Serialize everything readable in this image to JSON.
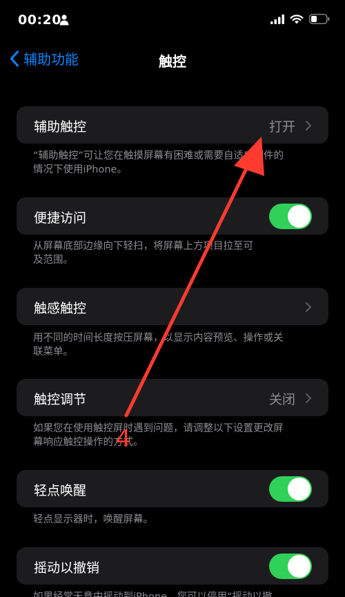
{
  "status_bar": {
    "time": "00:20",
    "icons": [
      "person-icon",
      "signal-icon",
      "wifi-icon",
      "battery-icon"
    ]
  },
  "nav": {
    "back_label": "辅助功能",
    "title": "触控"
  },
  "sections": [
    {
      "label": "辅助触控",
      "value": "打开",
      "control": "chevron",
      "footer": "“辅助触控”可让您在触摸屏幕有困难或需要自适应配件的\n情况下使用iPhone。"
    },
    {
      "label": "便捷访问",
      "control": "toggle",
      "toggle_on": true,
      "footer": "从屏幕底部边缘向下轻扫，将屏幕上方项目拉至可\n及范围。"
    },
    {
      "label": "触感触控",
      "value": "",
      "control": "chevron",
      "footer": "用不同的时间长度按压屏幕，以显示内容预览、操作或关\n联菜单。"
    },
    {
      "label": "触控调节",
      "value": "关闭",
      "control": "chevron",
      "footer": "如果您在使用触控屏时遇到问题，请调整以下设置更改屏\n幕响应触控操作的方式。"
    },
    {
      "label": "轻点唤醒",
      "control": "toggle",
      "toggle_on": true,
      "footer": "轻点显示器时，唤醒屏幕。"
    },
    {
      "label": "摇动以撤销",
      "control": "toggle",
      "toggle_on": true,
      "footer": "如果经常无意中摇动到iPhone，您可以停用“摇动以撤"
    }
  ],
  "annotation": {
    "step_number": "4",
    "color": "#ff3b30"
  },
  "colors": {
    "accent": "#0a84ff",
    "toggle_on": "#30d158",
    "cell_bg": "#1c1c1e",
    "secondary_text": "#8d8d93"
  }
}
